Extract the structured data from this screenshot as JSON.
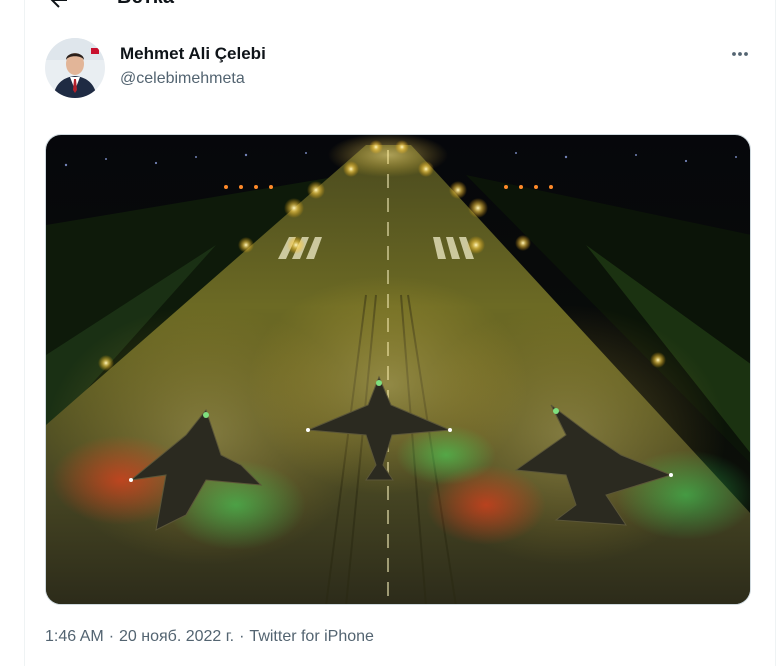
{
  "header": {
    "title": "Ветка",
    "back_icon": "arrow-left-icon"
  },
  "tweet": {
    "author_name": "Mehmet Ali Çelebi",
    "author_handle": "@celebimehmeta",
    "more_icon": "more-horizontal-icon",
    "media_description": "",
    "time": "1:46 AM",
    "date": "20 нояб. 2022 г.",
    "source": "Twitter for iPhone",
    "separator": "·"
  },
  "colors": {
    "text_primary": "#0f1419",
    "text_secondary": "#536471",
    "border": "#eff3f4"
  }
}
